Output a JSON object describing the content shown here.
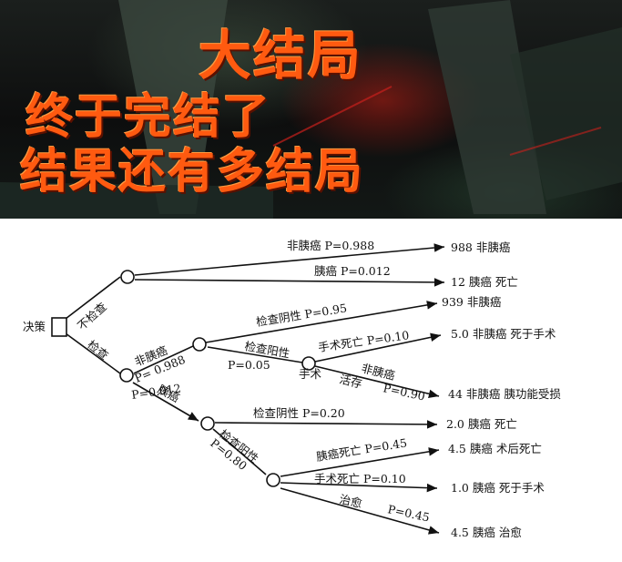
{
  "banner": {
    "title": "大结局",
    "line2": "终于完结了",
    "line3": "结果还有多结局"
  },
  "tree": {
    "decision_label": "决策",
    "branch_no_exam": "不检查",
    "branch_exam": "检查",
    "no_exam_non_cancer": "非胰癌 P=0.988",
    "no_exam_cancer": "胰癌 P=0.012",
    "outcome_988": "988 非胰癌",
    "outcome_12": "12 胰癌 死亡",
    "exam_non_cancer": "非胰癌",
    "exam_non_cancer_p": "P= 0.988",
    "exam_cancer": "胰癌",
    "exam_cancer_p": "P=0.012",
    "neg_095": "检查阴性 P=0.95",
    "outcome_939": "939 非胰癌",
    "pos_005": "检查阳性",
    "pos_005_p": "P=0.05",
    "surgery": "手术",
    "surgery_death": "手术死亡 P=0.10",
    "outcome_50": "5.0 非胰癌 死于手术",
    "survive": "活存",
    "survive_non_cancer": "非胰癌",
    "survive_p": "P=0.90",
    "outcome_44": "44 非胰癌 胰功能受损",
    "neg_020": "检查阴性 P=0.20",
    "outcome_20": "2.0 胰癌 死亡",
    "pos_080": "检查阳性",
    "pos_080_p": "P=0.80",
    "post_op_death": "胰癌死亡 P=0.45",
    "outcome_45a": "4.5 胰癌 术后死亡",
    "surgery_death2": "手术死亡 P=0.10",
    "outcome_10": "1.0 胰癌 死于手术",
    "cured": "治愈",
    "cured_p": "P=0.45",
    "outcome_45b": "4.5 胰癌 治愈"
  }
}
